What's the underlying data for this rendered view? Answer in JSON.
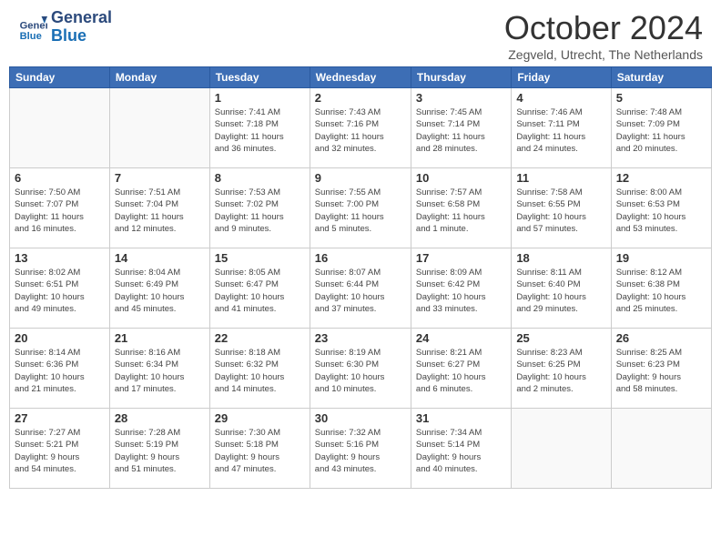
{
  "header": {
    "logo_line1": "General",
    "logo_line2": "Blue",
    "month": "October 2024",
    "location": "Zegveld, Utrecht, The Netherlands"
  },
  "weekdays": [
    "Sunday",
    "Monday",
    "Tuesday",
    "Wednesday",
    "Thursday",
    "Friday",
    "Saturday"
  ],
  "weeks": [
    [
      {
        "day": "",
        "info": ""
      },
      {
        "day": "",
        "info": ""
      },
      {
        "day": "1",
        "info": "Sunrise: 7:41 AM\nSunset: 7:18 PM\nDaylight: 11 hours\nand 36 minutes."
      },
      {
        "day": "2",
        "info": "Sunrise: 7:43 AM\nSunset: 7:16 PM\nDaylight: 11 hours\nand 32 minutes."
      },
      {
        "day": "3",
        "info": "Sunrise: 7:45 AM\nSunset: 7:14 PM\nDaylight: 11 hours\nand 28 minutes."
      },
      {
        "day": "4",
        "info": "Sunrise: 7:46 AM\nSunset: 7:11 PM\nDaylight: 11 hours\nand 24 minutes."
      },
      {
        "day": "5",
        "info": "Sunrise: 7:48 AM\nSunset: 7:09 PM\nDaylight: 11 hours\nand 20 minutes."
      }
    ],
    [
      {
        "day": "6",
        "info": "Sunrise: 7:50 AM\nSunset: 7:07 PM\nDaylight: 11 hours\nand 16 minutes."
      },
      {
        "day": "7",
        "info": "Sunrise: 7:51 AM\nSunset: 7:04 PM\nDaylight: 11 hours\nand 12 minutes."
      },
      {
        "day": "8",
        "info": "Sunrise: 7:53 AM\nSunset: 7:02 PM\nDaylight: 11 hours\nand 9 minutes."
      },
      {
        "day": "9",
        "info": "Sunrise: 7:55 AM\nSunset: 7:00 PM\nDaylight: 11 hours\nand 5 minutes."
      },
      {
        "day": "10",
        "info": "Sunrise: 7:57 AM\nSunset: 6:58 PM\nDaylight: 11 hours\nand 1 minute."
      },
      {
        "day": "11",
        "info": "Sunrise: 7:58 AM\nSunset: 6:55 PM\nDaylight: 10 hours\nand 57 minutes."
      },
      {
        "day": "12",
        "info": "Sunrise: 8:00 AM\nSunset: 6:53 PM\nDaylight: 10 hours\nand 53 minutes."
      }
    ],
    [
      {
        "day": "13",
        "info": "Sunrise: 8:02 AM\nSunset: 6:51 PM\nDaylight: 10 hours\nand 49 minutes."
      },
      {
        "day": "14",
        "info": "Sunrise: 8:04 AM\nSunset: 6:49 PM\nDaylight: 10 hours\nand 45 minutes."
      },
      {
        "day": "15",
        "info": "Sunrise: 8:05 AM\nSunset: 6:47 PM\nDaylight: 10 hours\nand 41 minutes."
      },
      {
        "day": "16",
        "info": "Sunrise: 8:07 AM\nSunset: 6:44 PM\nDaylight: 10 hours\nand 37 minutes."
      },
      {
        "day": "17",
        "info": "Sunrise: 8:09 AM\nSunset: 6:42 PM\nDaylight: 10 hours\nand 33 minutes."
      },
      {
        "day": "18",
        "info": "Sunrise: 8:11 AM\nSunset: 6:40 PM\nDaylight: 10 hours\nand 29 minutes."
      },
      {
        "day": "19",
        "info": "Sunrise: 8:12 AM\nSunset: 6:38 PM\nDaylight: 10 hours\nand 25 minutes."
      }
    ],
    [
      {
        "day": "20",
        "info": "Sunrise: 8:14 AM\nSunset: 6:36 PM\nDaylight: 10 hours\nand 21 minutes."
      },
      {
        "day": "21",
        "info": "Sunrise: 8:16 AM\nSunset: 6:34 PM\nDaylight: 10 hours\nand 17 minutes."
      },
      {
        "day": "22",
        "info": "Sunrise: 8:18 AM\nSunset: 6:32 PM\nDaylight: 10 hours\nand 14 minutes."
      },
      {
        "day": "23",
        "info": "Sunrise: 8:19 AM\nSunset: 6:30 PM\nDaylight: 10 hours\nand 10 minutes."
      },
      {
        "day": "24",
        "info": "Sunrise: 8:21 AM\nSunset: 6:27 PM\nDaylight: 10 hours\nand 6 minutes."
      },
      {
        "day": "25",
        "info": "Sunrise: 8:23 AM\nSunset: 6:25 PM\nDaylight: 10 hours\nand 2 minutes."
      },
      {
        "day": "26",
        "info": "Sunrise: 8:25 AM\nSunset: 6:23 PM\nDaylight: 9 hours\nand 58 minutes."
      }
    ],
    [
      {
        "day": "27",
        "info": "Sunrise: 7:27 AM\nSunset: 5:21 PM\nDaylight: 9 hours\nand 54 minutes."
      },
      {
        "day": "28",
        "info": "Sunrise: 7:28 AM\nSunset: 5:19 PM\nDaylight: 9 hours\nand 51 minutes."
      },
      {
        "day": "29",
        "info": "Sunrise: 7:30 AM\nSunset: 5:18 PM\nDaylight: 9 hours\nand 47 minutes."
      },
      {
        "day": "30",
        "info": "Sunrise: 7:32 AM\nSunset: 5:16 PM\nDaylight: 9 hours\nand 43 minutes."
      },
      {
        "day": "31",
        "info": "Sunrise: 7:34 AM\nSunset: 5:14 PM\nDaylight: 9 hours\nand 40 minutes."
      },
      {
        "day": "",
        "info": ""
      },
      {
        "day": "",
        "info": ""
      }
    ]
  ]
}
